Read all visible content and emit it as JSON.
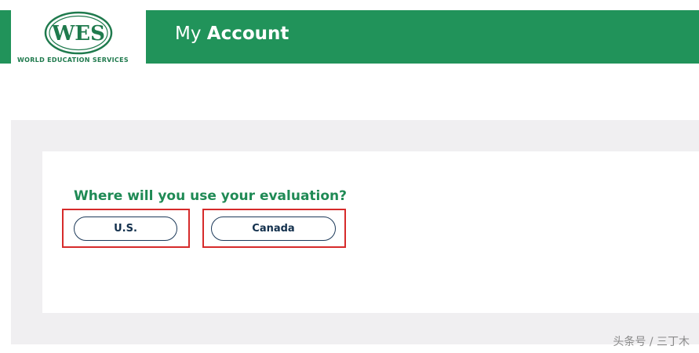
{
  "header": {
    "logo_text": "WES",
    "logo_subtitle": "WORLD EDUCATION SERVICES",
    "title_light": "My ",
    "title_bold": "Account"
  },
  "main": {
    "question": "Where will you use your evaluation?",
    "options": [
      {
        "label": "U.S."
      },
      {
        "label": "Canada"
      }
    ]
  },
  "watermark": "头条号 / 三丁木",
  "colors": {
    "brand_green": "#21935a",
    "question_green": "#1f8a55",
    "button_border": "#1d3a5a",
    "highlight_red": "#d62b2b",
    "panel_gray": "#f0eff1"
  }
}
